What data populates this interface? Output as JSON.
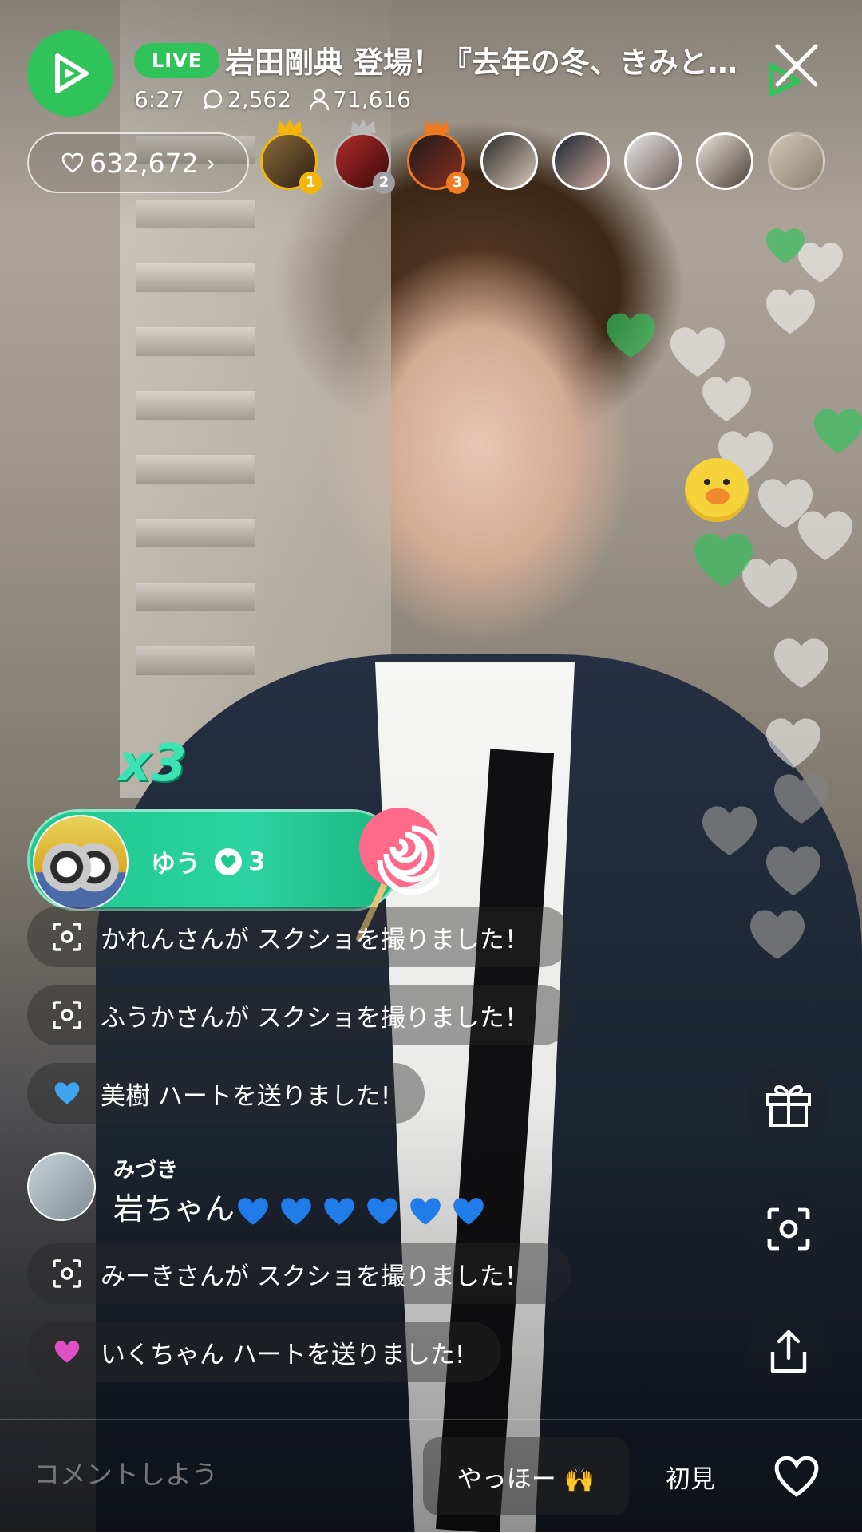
{
  "header": {
    "live_label": "LIVE",
    "title": "岩田剛典 登場！『去年の冬、きみと…",
    "elapsed": "6:27",
    "comment_count": "2,562",
    "viewer_count": "71,616"
  },
  "likes": {
    "count": "632,672",
    "chevron": "›"
  },
  "top_viewers": [
    {
      "rank": "1",
      "rank_color": "#f5b50a"
    },
    {
      "rank": "2",
      "rank_color": "#9e9e9e"
    },
    {
      "rank": "3",
      "rank_color": "#f07a1f"
    }
  ],
  "gift": {
    "combo": "x3",
    "user": "ゆう",
    "count": "3",
    "icon": "lollipop-icon"
  },
  "messages": [
    {
      "icon": "screenshot-icon",
      "text": "かれんさんが スクショを撮りました！"
    },
    {
      "icon": "screenshot-icon",
      "text": "ふうかさんが スクショを撮りました！"
    },
    {
      "icon": "heart-icon",
      "heart_color": "#3fa4ef",
      "text": "美樹 ハートを送りました!"
    },
    {
      "icon": "screenshot-icon",
      "text": "みーきさんが スクショを撮りました！"
    },
    {
      "icon": "heart-icon",
      "heart_color": "#e04fc4",
      "text": "いくちゃん ハートを送りました!"
    }
  ],
  "comment": {
    "name": "みづき",
    "text": "岩ちゃん",
    "emoji": "blue-heart-icon",
    "emoji_count": 6
  },
  "side_actions": [
    "gift-icon",
    "screenshot-icon",
    "share-icon"
  ],
  "bottom": {
    "placeholder": "コメントしよう",
    "quick1": "やっほー 🙌",
    "quick2": "初見"
  },
  "colors": {
    "brand_green": "#2fc35a",
    "gift_teal": "#1fc98e"
  }
}
